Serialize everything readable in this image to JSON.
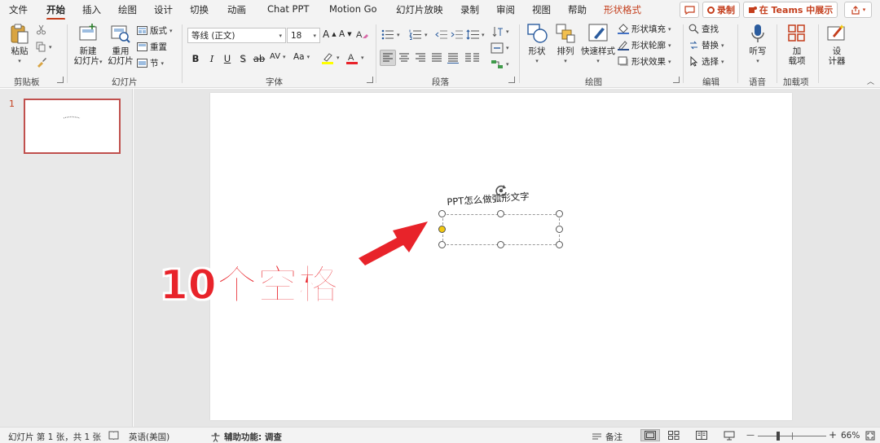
{
  "tabs": {
    "file": "文件",
    "home": "开始",
    "insert": "插入",
    "draw": "绘图",
    "design": "设计",
    "transitions": "切换",
    "animations": "动画",
    "chatppt": "Chat PPT",
    "motiongo": "Motion Go",
    "slideshow": "幻灯片放映",
    "record": "录制",
    "review": "审阅",
    "view": "视图",
    "help": "帮助",
    "shape_format": "形状格式"
  },
  "topbar": {
    "record_btn": "录制",
    "teams_btn": "在 Teams 中展示"
  },
  "ribbon": {
    "clipboard": {
      "paste": "粘贴",
      "label": "剪贴板"
    },
    "slides": {
      "new_slide_l1": "新建",
      "new_slide_l2": "幻灯片",
      "reuse_l1": "重用",
      "reuse_l2": "幻灯片",
      "layout": "版式",
      "reset": "重置",
      "section": "节",
      "label": "幻灯片"
    },
    "font": {
      "font_name": "等线 (正文)",
      "font_size": "18",
      "grow": "A",
      "shrink": "A",
      "bold": "B",
      "italic": "I",
      "underline": "U",
      "shadow": "S",
      "strike": "ab",
      "spacing": "AV",
      "case": "Aa",
      "label": "字体"
    },
    "paragraph": {
      "label": "段落"
    },
    "drawing": {
      "shapes": "形状",
      "arrange": "排列",
      "quick_styles": "快速样式",
      "shape_fill": "形状填充",
      "shape_outline": "形状轮廓",
      "shape_effects": "形状效果",
      "label": "绘图"
    },
    "editing": {
      "find": "查找",
      "replace": "替换",
      "select": "选择",
      "label": "编辑"
    },
    "voice": {
      "dictate": "听写",
      "label": "语音"
    },
    "addins": {
      "addins_l1": "加",
      "addins_l2": "载项",
      "label": "加载项"
    },
    "designer": {
      "designer_l1": "设",
      "designer_l2": "计器"
    }
  },
  "thumbnail": {
    "number": "1"
  },
  "slide": {
    "textbox_text": "PPT怎么做弧形文字",
    "overlay_text": "10个空格"
  },
  "colors": {
    "accent": "#c43e1c",
    "arrow": "#e8232a",
    "overlay": "#e8232a",
    "handle_yellow": "#f2c811"
  },
  "statusbar": {
    "slide_info": "幻灯片 第 1 张，共 1 张",
    "language": "英语(美国)",
    "accessibility": "辅助功能: 调查",
    "notes": "备注",
    "zoom": "66%",
    "minus": "—",
    "plus": "+"
  }
}
